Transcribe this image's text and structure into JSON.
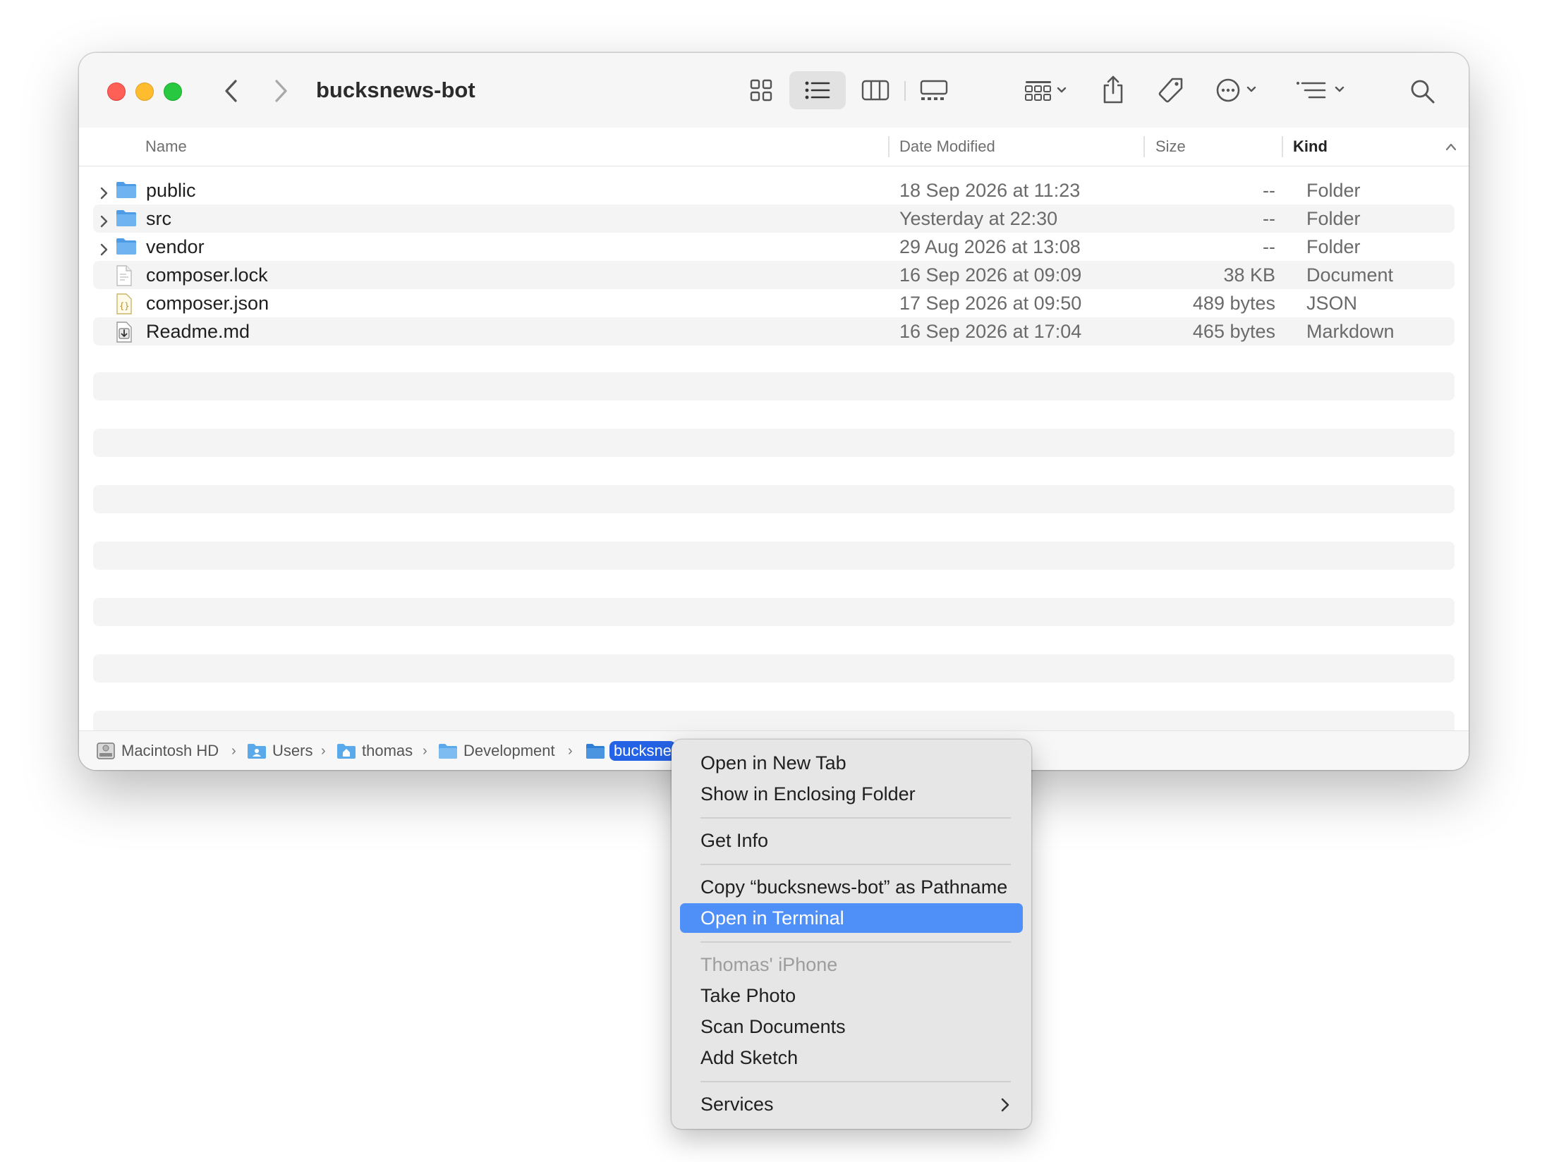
{
  "window": {
    "title": "bucksnews-bot"
  },
  "toolbar": {
    "icons": [
      "back-icon",
      "forward-icon",
      "icon-view-icon",
      "list-view-icon",
      "column-view-icon",
      "gallery-view-icon",
      "group-icon",
      "share-icon",
      "tag-icon",
      "more-actions-icon",
      "sort-options-icon",
      "search-icon"
    ],
    "active_view": "list"
  },
  "columns": {
    "name": "Name",
    "date_modified": "Date Modified",
    "size": "Size",
    "kind": "Kind"
  },
  "files": [
    {
      "name": "public",
      "date": "18 Sep 2026 at 11:23",
      "size": "--",
      "kind": "Folder",
      "icon": "folder-icon",
      "expandable": true
    },
    {
      "name": "src",
      "date": "Yesterday at 22:30",
      "size": "--",
      "kind": "Folder",
      "icon": "folder-icon",
      "expandable": true
    },
    {
      "name": "vendor",
      "date": "29 Aug 2026 at 13:08",
      "size": "--",
      "kind": "Folder",
      "icon": "folder-icon",
      "expandable": true
    },
    {
      "name": "composer.lock",
      "date": "16 Sep 2026 at 09:09",
      "size": "38 KB",
      "kind": "Document",
      "icon": "document-icon",
      "expandable": false
    },
    {
      "name": "composer.json",
      "date": "17 Sep 2026 at 09:50",
      "size": "489 bytes",
      "kind": "JSON",
      "icon": "json-file-icon",
      "expandable": false
    },
    {
      "name": "Readme.md",
      "date": "16 Sep 2026 at 17:04",
      "size": "465 bytes",
      "kind": "Markdown",
      "icon": "markdown-file-icon",
      "expandable": false
    }
  ],
  "pathbar": {
    "items": [
      "Macintosh HD",
      "Users",
      "thomas",
      "Development",
      "bucksne"
    ]
  },
  "context_menu": {
    "items": {
      "open_new_tab": "Open in New Tab",
      "show_enclosing": "Show in Enclosing Folder",
      "get_info": "Get Info",
      "copy_pathname": "Copy “bucksnews-bot” as Pathname",
      "open_terminal": "Open in Terminal",
      "device_header": "Thomas' iPhone",
      "take_photo": "Take Photo",
      "scan_documents": "Scan Documents",
      "add_sketch": "Add Sketch",
      "services": "Services"
    },
    "highlighted": "open_terminal"
  },
  "colors": {
    "highlight": "#4e8ff8",
    "path_selected": "#2563e6",
    "folder": "#5aa9ea",
    "close": "#fe5f57",
    "minimize": "#febc2e",
    "zoom": "#28c840"
  }
}
